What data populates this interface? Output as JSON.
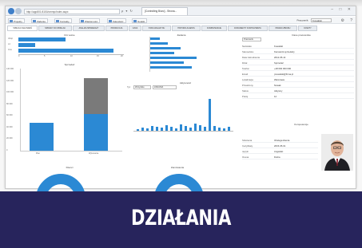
{
  "browser": {
    "address": "http://app801:8150/ommp/index.aspx",
    "tab_title": "[Controlling Biuro] - Strona...",
    "address_icons": "ρ ▾ ↻",
    "window_controls": "– □ ✕"
  },
  "toolbar": {
    "items": [
      "Projekty",
      "Zadania",
      "Kontakty",
      "Wiadomości",
      "Kalendarz",
      "Notatki"
    ],
    "user_label": "Pracownik:",
    "user_value": "Kowalski"
  },
  "module_tabs": [
    "TABLICA OGŁOSZEŃ",
    "SPRAWY DO OBSŁUGI",
    "ANALIZA SPRZEDAŻY",
    "PRODUKCJA",
    "CZAS",
    "STAN MAGAZYNU",
    "HISTORIA KLIENTA",
    "KOMPETENCJE",
    "DOKUMENTY KONTRAHENTA",
    "PRAWO ZBIORU",
    "KOSZTY"
  ],
  "charts": {
    "top_left_title": "Dni wolne",
    "hbar_labels": [
      "Urlop",
      "L4",
      "Inne"
    ],
    "hbar_values": [
      0.45,
      0.16,
      0.9
    ],
    "hbar_ticks": [
      "0",
      "5",
      "10",
      "15",
      "20"
    ],
    "vbar_title": "Sprzedaż",
    "vbar_y_ticks": [
      "140 000",
      "120 000",
      "100 000",
      "80 000",
      "60 000",
      "40 000",
      "20 000",
      "0"
    ],
    "vbar_categories": [
      "Plan",
      "Wykonanie"
    ],
    "mid_top_title": "Zadania",
    "mid_hbar_values": [
      0.12,
      0.22,
      0.38,
      0.3,
      0.58,
      0.42,
      0.52
    ],
    "mid_bottom_title": "Aktywność",
    "mid_filter_label": "Typ:",
    "mid_filter_value": "Wszystkie",
    "mid_filter_extra": "ZADANIA",
    "donut_left_title": "Klienci",
    "donut_right_title": "Zamówienia"
  },
  "detail": {
    "title": "Dane pracownika",
    "tab_left": "Pracownik",
    "rows": [
      {
        "k": "Nazwisko",
        "v": "Kowalski"
      },
      {
        "k": "Stanowisko",
        "v": "Kierownik sprzedaży"
      },
      {
        "k": "Data zatrudnienia",
        "v": "2012-05-14"
      },
      {
        "k": "Dział",
        "v": "Sprzedaż"
      },
      {
        "k": "Telefon",
        "v": "+48 600 000 000"
      },
      {
        "k": "Email",
        "v": "j.kowalski@firma.pl"
      },
      {
        "k": "Lokalizacja",
        "v": "Warszawa"
      },
      {
        "k": "Przełożony",
        "v": "Nowak"
      },
      {
        "k": "Status",
        "v": "Aktywny"
      },
      {
        "k": "Pokój",
        "v": "12"
      }
    ],
    "section2": "Kompetencje",
    "rows2": [
      {
        "k": "Szkolenia",
        "v": "Obsługa klienta"
      },
      {
        "k": "Certyfikaty",
        "v": "2015-05-01"
      },
      {
        "k": "Języki",
        "v": "Angielski"
      },
      {
        "k": "Ocena",
        "v": "Dobra"
      }
    ]
  },
  "banner": {
    "title": "DZIAŁANIA"
  },
  "colors": {
    "accent": "#2b89d4",
    "grey_bar": "#7a7a7a",
    "banner": "#27245c"
  }
}
